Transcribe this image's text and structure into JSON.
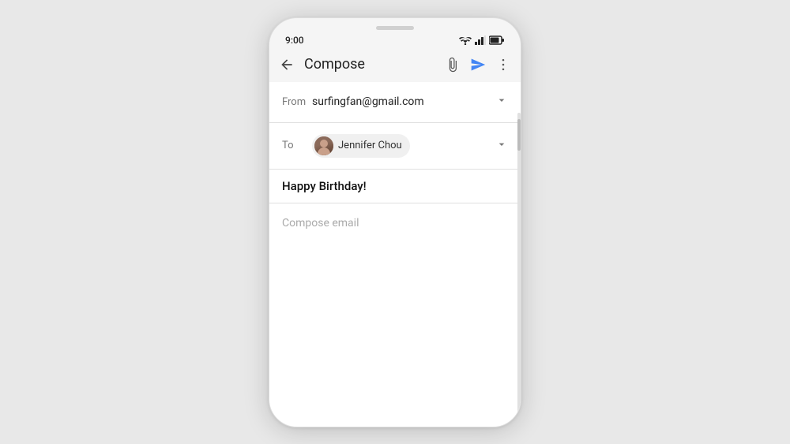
{
  "phone": {
    "speaker_aria": "phone-speaker"
  },
  "status_bar": {
    "time": "9:00",
    "wifi_aria": "wifi-signal",
    "signal_aria": "cellular-signal",
    "battery_aria": "battery"
  },
  "toolbar": {
    "back_aria": "back-arrow",
    "title": "Compose",
    "attach_aria": "attach-icon",
    "send_aria": "send-icon",
    "more_aria": "more-options-icon"
  },
  "compose": {
    "from_label": "From",
    "from_value": "surfingfan@gmail.com",
    "to_label": "To",
    "recipient_name": "Jennifer Chou",
    "subject": "Happy Birthday!",
    "body_placeholder": "Compose email",
    "expand_icon": "expand-icon"
  },
  "colors": {
    "send_blue": "#4285F4",
    "divider": "#e0e0e0",
    "label_gray": "#777",
    "chip_bg": "#f0f0f0"
  }
}
